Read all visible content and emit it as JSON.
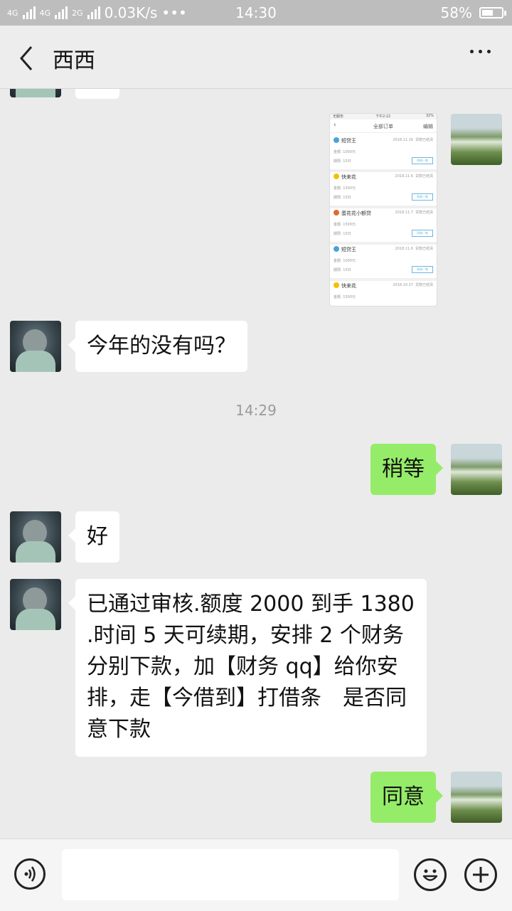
{
  "status_bar": {
    "network_left": "4G",
    "network_mid": "4G",
    "network_2g": "2G",
    "speed": "0.03K/s",
    "dots": "•••",
    "time": "14:30",
    "battery": "58%",
    "battery_level": 0.58
  },
  "header": {
    "title": "西西",
    "back_icon": "chevron-left-icon",
    "more_icon": "more-dots-icon"
  },
  "messages": [
    {
      "side": "left",
      "text": ""
    },
    {
      "side": "right",
      "type": "image"
    },
    {
      "side": "left",
      "text": "今年的没有吗？"
    },
    {
      "side": "right",
      "text": "稍等"
    },
    {
      "side": "left",
      "text": "好"
    },
    {
      "side": "left",
      "text": "已通过审核.额度 2000 到手 1380 .时间 5 天可续期，安排 2 个财务分别下款，加【财务 qq】给你安排，走【今借到】打借条　是否同意下款"
    },
    {
      "side": "right",
      "text": "同意"
    }
  ],
  "timestamp": "14:29",
  "screenshot_image": {
    "status_left": "无服务",
    "status_time": "下午2:22",
    "status_right": "32%",
    "title": "全部订单",
    "edit": "编辑",
    "orders": [
      {
        "name": "短贷王",
        "date": "2018.11.16",
        "status": "贷款已结清",
        "amount": "金额: 1000元",
        "term": "期限: 15日",
        "button": "再借一笔",
        "icon_color": "#4aa3d8"
      },
      {
        "name": "快来花",
        "date": "2018.11.6",
        "status": "贷款已结清",
        "amount": "金额: 1500元",
        "term": "期限: 15日",
        "button": "再借一笔",
        "icon_color": "#f2c200"
      },
      {
        "name": "蛋花花小额贷",
        "date": "2018.11.7",
        "status": "贷款已结清",
        "amount": "金额: 1500元",
        "term": "期限: 15日",
        "button": "再借一笔",
        "icon_color": "#e26a2c"
      },
      {
        "name": "短贷王",
        "date": "2018.11.6",
        "status": "贷款已结清",
        "amount": "金额: 1000元",
        "term": "期限: 15日",
        "button": "再借一笔",
        "icon_color": "#4aa3d8"
      },
      {
        "name": "快来花",
        "date": "2018.10.27",
        "status": "贷款已结清",
        "amount": "金额: 1500元",
        "term": "",
        "button": "",
        "icon_color": "#f2c200"
      }
    ]
  },
  "footer": {
    "voice_icon": "voice-icon",
    "emoji_icon": "emoji-icon",
    "plus_icon": "plus-icon"
  },
  "colors": {
    "bubble_right": "#95ec69",
    "bubble_left": "#ffffff",
    "background": "#ebebeb"
  }
}
